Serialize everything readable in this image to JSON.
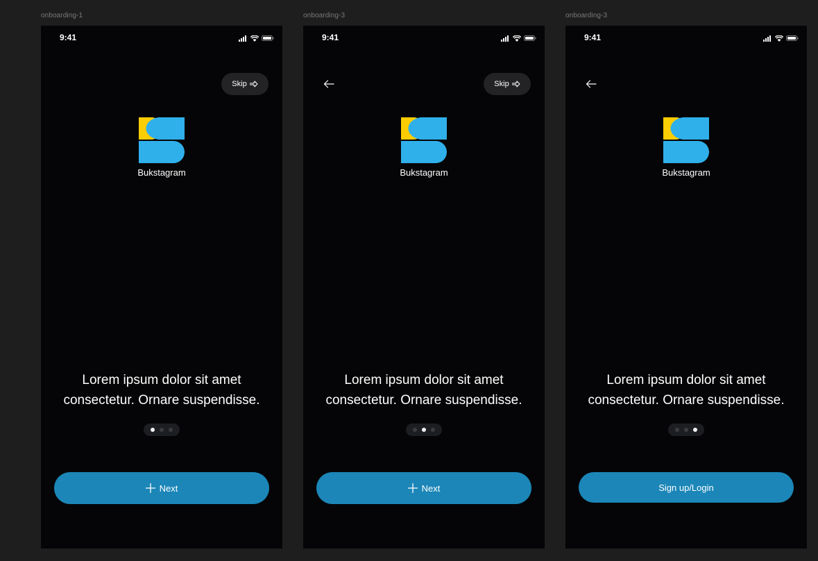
{
  "frames": [
    {
      "label": "onboarding-1",
      "time": "9:41",
      "show_back": false,
      "show_skip": true,
      "skip_label": "Skip",
      "app_name": "Bukstagram",
      "tagline_line1": "Lorem ipsum dolor sit amet",
      "tagline_line2": "consectetur. Ornare suspendisse.",
      "active_dot": 0,
      "cta_label": "Next",
      "cta_icon": "plus-icon"
    },
    {
      "label": "onboarding-3",
      "time": "9:41",
      "show_back": true,
      "show_skip": true,
      "skip_label": "Skip",
      "app_name": "Bukstagram",
      "tagline_line1": "Lorem ipsum dolor sit amet",
      "tagline_line2": "consectetur. Ornare suspendisse.",
      "active_dot": 1,
      "cta_label": "Next",
      "cta_icon": "plus-icon"
    },
    {
      "label": "onboarding-3",
      "time": "9:41",
      "show_back": true,
      "show_skip": false,
      "app_name": "Bukstagram",
      "tagline_line1": "Lorem ipsum dolor sit amet",
      "tagline_line2": "consectetur. Ornare suspendisse.",
      "active_dot": 2,
      "cta_label": "Sign up/Login",
      "cta_icon": null
    }
  ],
  "colors": {
    "canvas": "#1e1e1e",
    "screen_bg": "#050507",
    "cta_bg": "#1b86b7",
    "logo_yellow": "#fccd03",
    "logo_blue": "#2fb0ea"
  }
}
